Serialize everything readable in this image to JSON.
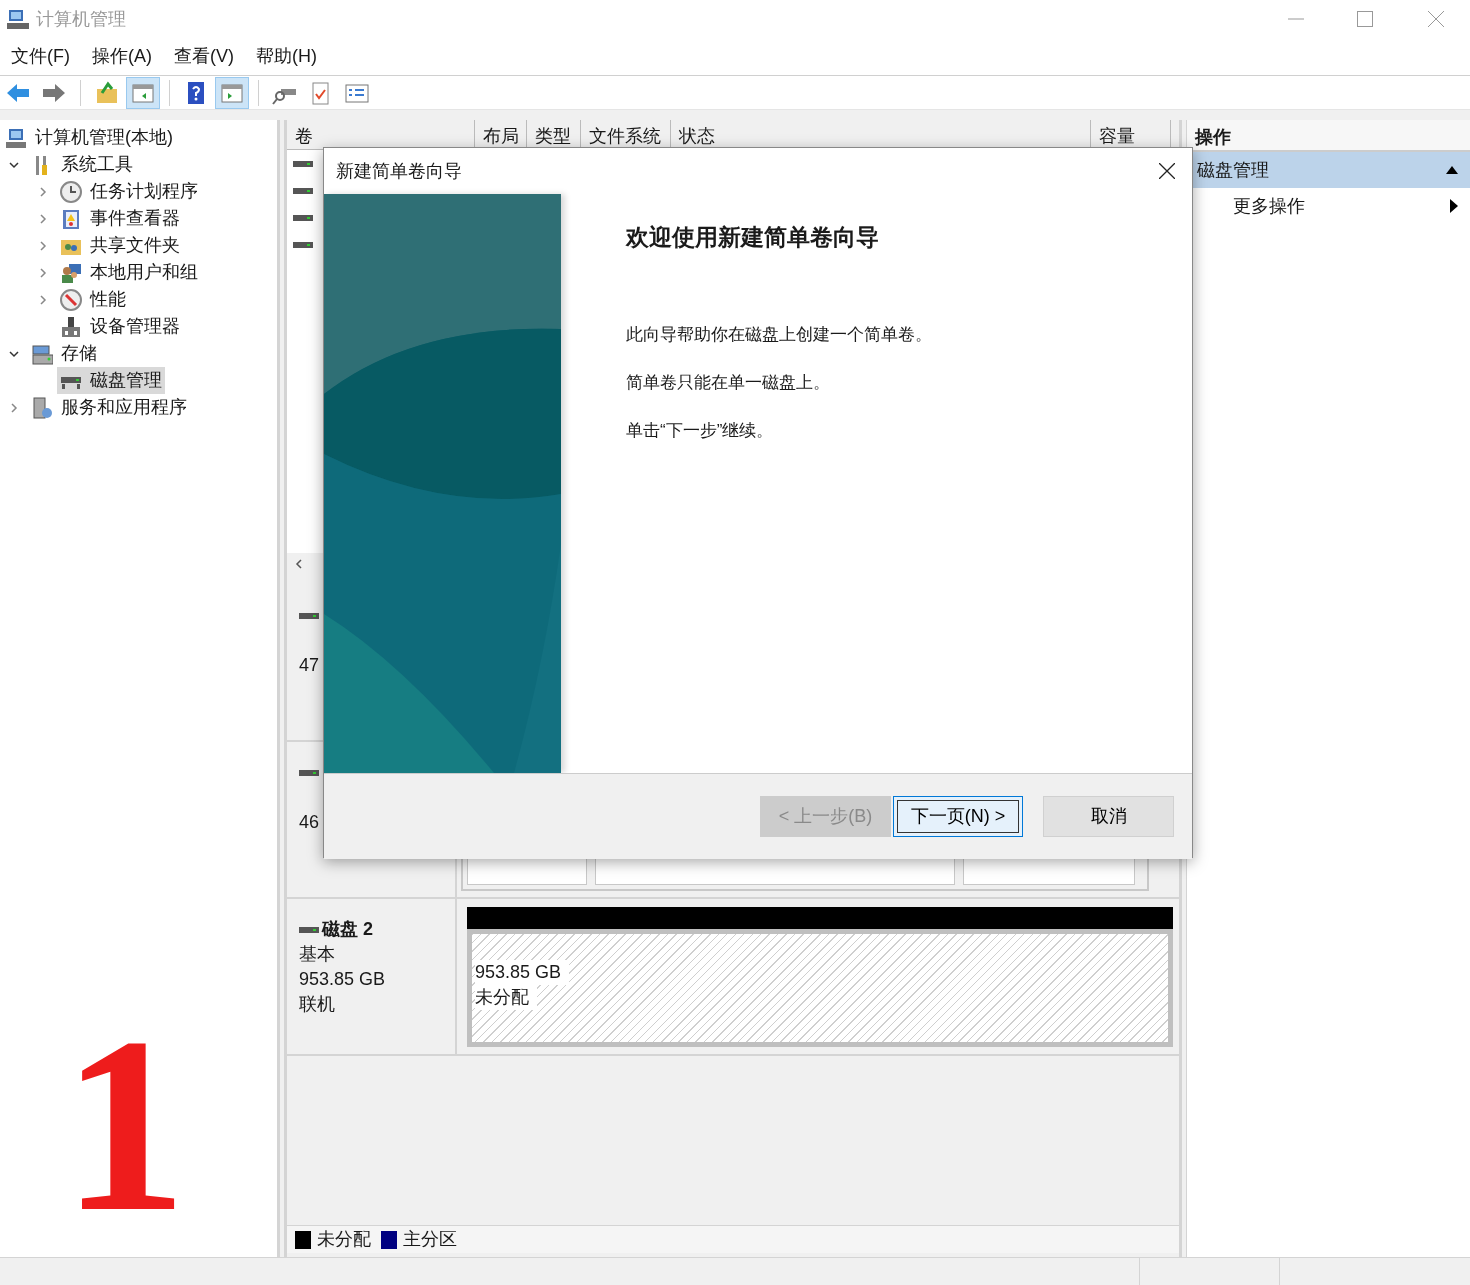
{
  "window": {
    "title": "计算机管理"
  },
  "menu": [
    "文件(F)",
    "操作(A)",
    "查看(V)",
    "帮助(H)"
  ],
  "toolbar": [
    {
      "kind": "back",
      "pressed": false
    },
    {
      "kind": "forward",
      "pressed": false
    },
    {
      "kind": "sep"
    },
    {
      "kind": "up",
      "pressed": false
    },
    {
      "kind": "tree",
      "pressed": true
    },
    {
      "kind": "sep"
    },
    {
      "kind": "help",
      "pressed": false
    },
    {
      "kind": "pane",
      "pressed": true
    },
    {
      "kind": "sep"
    },
    {
      "kind": "connect",
      "pressed": false
    },
    {
      "kind": "check",
      "pressed": false
    },
    {
      "kind": "list",
      "pressed": false
    }
  ],
  "tree": [
    {
      "label": "计算机管理(本地)",
      "kind": "computer",
      "selected": false,
      "children": [
        {
          "label": "系统工具",
          "kind": "tools",
          "expanded": true,
          "selected": false,
          "children": [
            {
              "label": "任务计划程序",
              "kind": "clock",
              "expanded": false,
              "selected": false
            },
            {
              "label": "事件查看器",
              "kind": "log",
              "expanded": false,
              "selected": false
            },
            {
              "label": "共享文件夹",
              "kind": "folder",
              "expanded": false,
              "selected": false
            },
            {
              "label": "本地用户和组",
              "kind": "users",
              "expanded": false,
              "selected": false
            },
            {
              "label": "性能",
              "kind": "gauge",
              "expanded": false,
              "selected": false
            },
            {
              "label": "设备管理器",
              "kind": "device",
              "selected": false
            }
          ]
        },
        {
          "label": "存储",
          "kind": "storage",
          "expanded": true,
          "selected": false,
          "children": [
            {
              "label": "磁盘管理",
              "kind": "disk",
              "selected": true
            }
          ]
        },
        {
          "label": "服务和应用程序",
          "kind": "server",
          "expanded": false,
          "selected": false
        }
      ]
    }
  ],
  "volume_list": {
    "columns": [
      "卷",
      "布局",
      "类型",
      "文件系统",
      "状态",
      "容量"
    ]
  },
  "disks": [
    {
      "kind": "covered",
      "size": "47"
    },
    {
      "kind": "covered",
      "size": "46",
      "partitions": [
        {
          "kind": "covered"
        },
        {
          "kind": "covered"
        },
        {
          "kind": "covered"
        }
      ]
    },
    {
      "kind": "full",
      "name": "磁盘 2",
      "type": "基本",
      "size": "953.85 GB",
      "status": "联机",
      "partitions": [
        {
          "kind": "unallocated",
          "size": "953.85 GB",
          "label": "未分配"
        }
      ]
    }
  ],
  "legend": [
    {
      "label": "未分配",
      "color": "#000000"
    },
    {
      "label": "主分区",
      "color": "#000080"
    }
  ],
  "actions": {
    "title": "操作",
    "items": [
      {
        "label": "磁盘管理",
        "kind": "section",
        "selected": true
      },
      {
        "label": "更多操作",
        "kind": "submenu",
        "selected": false
      }
    ]
  },
  "dialog": {
    "title": "新建简单卷向导",
    "heading": "欢迎使用新建简单卷向导",
    "paragraphs": [
      "此向导帮助你在磁盘上创建一个简单卷。",
      "简单卷只能在单一磁盘上。",
      "单击“下一步”继续。"
    ],
    "buttons": [
      {
        "label": "< 上一步(B)",
        "disabled": true,
        "default": false
      },
      {
        "label": "下一页(N) >",
        "disabled": false,
        "default": true
      },
      {
        "label": "取消",
        "disabled": false,
        "default": false
      }
    ]
  },
  "annotation": {
    "text": "1"
  }
}
